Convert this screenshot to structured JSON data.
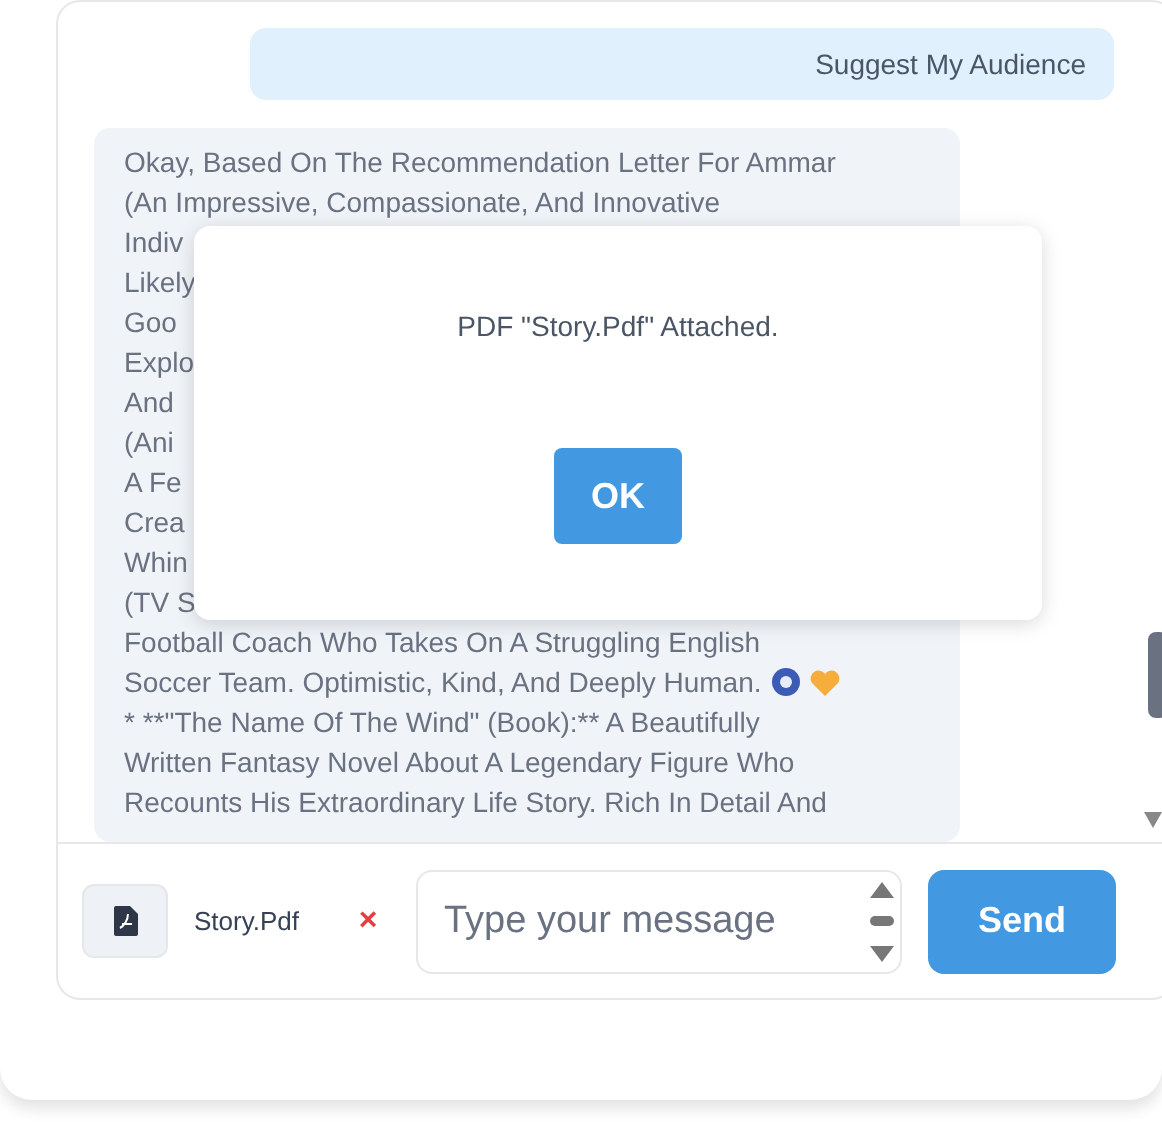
{
  "messages": [
    {
      "kind": "user",
      "lines": [
        "Suggest My Audience"
      ]
    },
    {
      "kind": "bot",
      "lines": [
        "Okay, Based On The Recommendation Letter For Ammar",
        "(An Impressive, Compassionate, And Innovative",
        "Indiv",
        "Likely",
        "Goo",
        "Explo",
        "And",
        "(Ani",
        "A Fe",
        "Crea",
        "Whin",
        "(TV S",
        "Football Coach Who Takes On A Struggling English",
        "Soccer Team. Optimistic, Kind, And Deeply Human.",
        "* **\"The Name Of The Wind\" (Book):** A Beautifully",
        "Written Fantasy Novel About A Legendary Figure Who",
        "Recounts His Extraordinary Life Story. Rich In Detail And"
      ]
    }
  ],
  "dialog": {
    "message": "PDF \"Story.Pdf\" Attached.",
    "button": "OK"
  },
  "composer": {
    "attachment": "Story.Pdf",
    "remove": "×",
    "placeholder": "Type your message",
    "send": "Send"
  }
}
